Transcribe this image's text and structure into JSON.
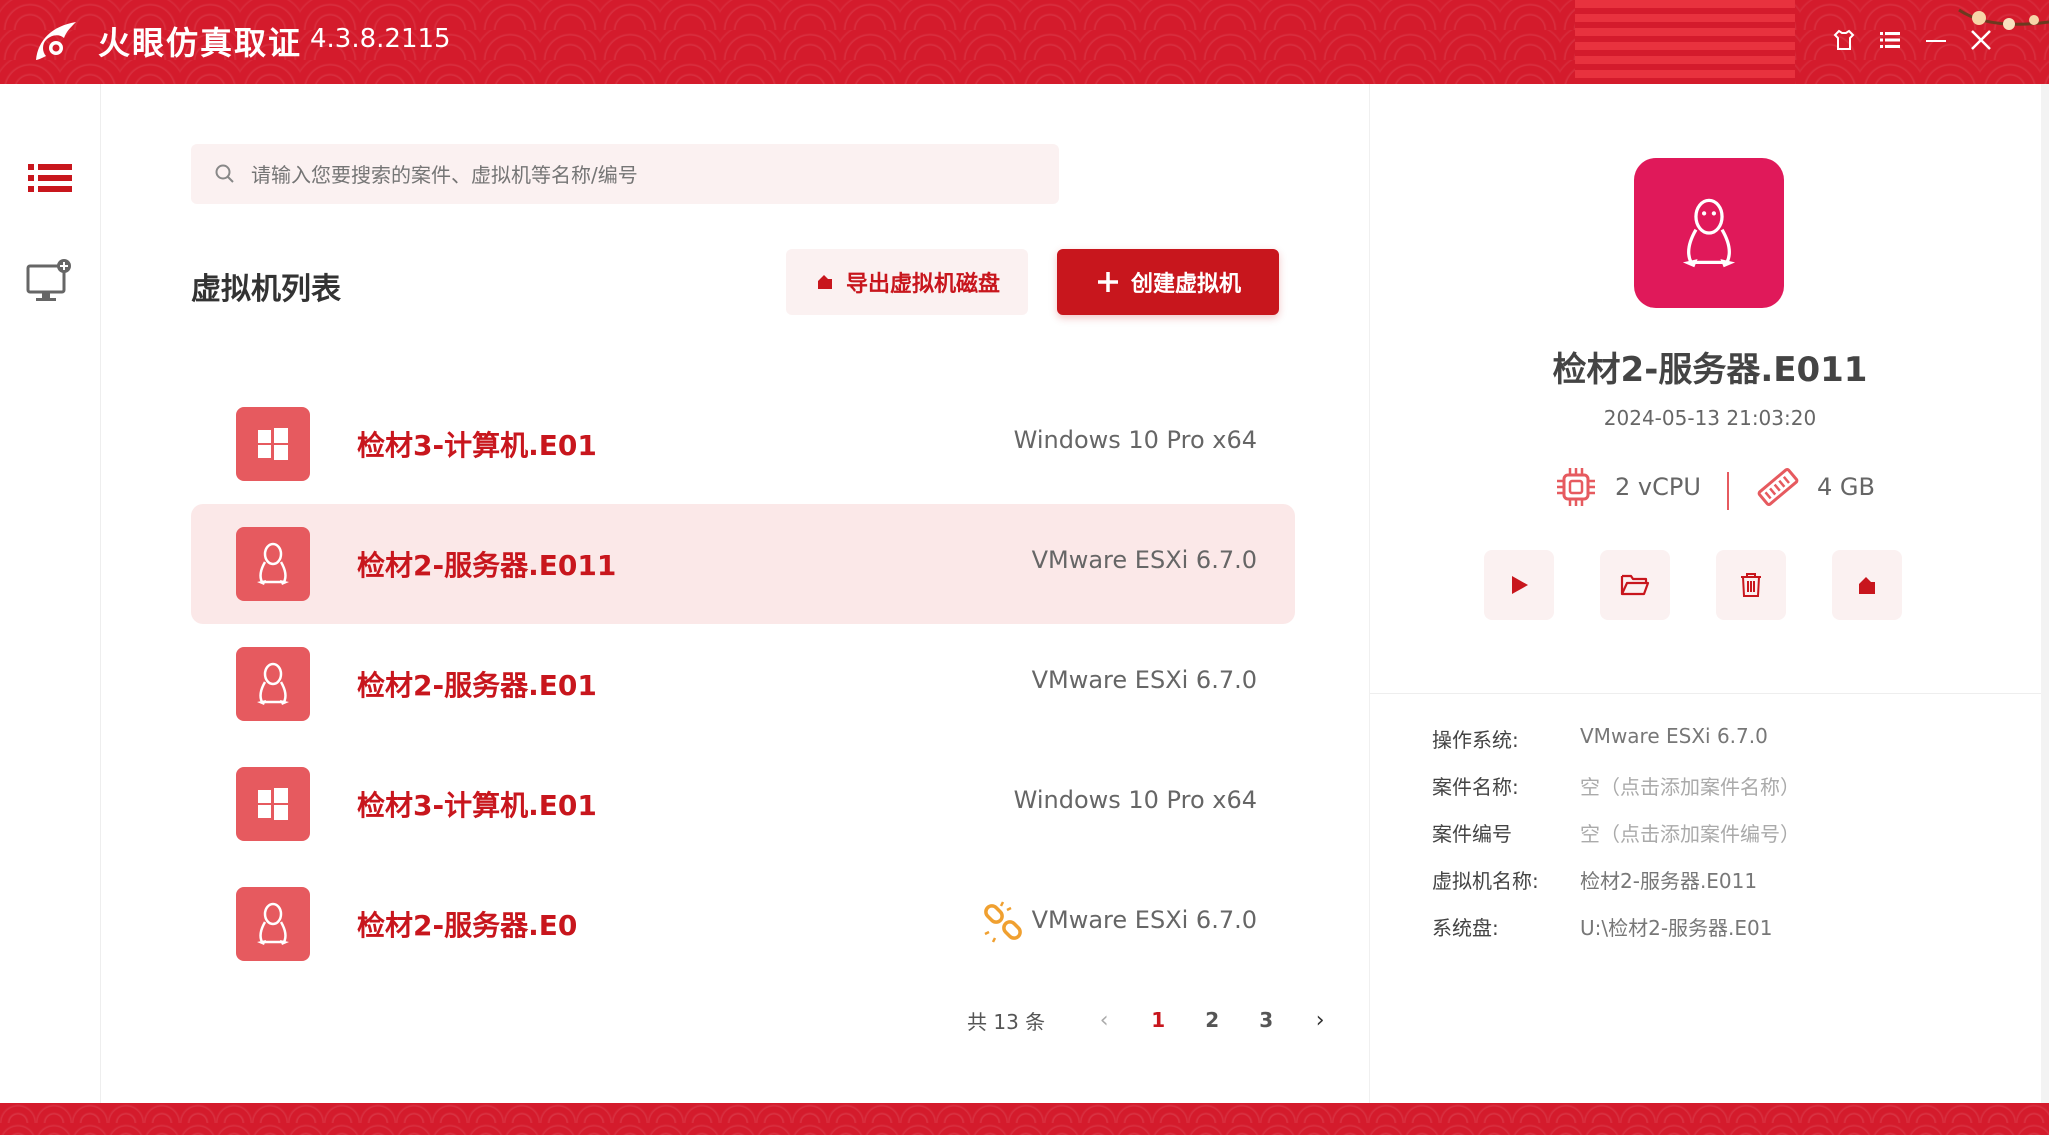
{
  "app": {
    "title": "火眼仿真取证",
    "version": "4.3.8.2115",
    "colors": {
      "brand": "#d41b2c",
      "accent": "#c8161d",
      "icon_bg": "#e65a5f",
      "linux_detail_bg": "#e0195a"
    }
  },
  "search": {
    "placeholder": "请输入您要搜索的案件、虚拟机等名称/编号"
  },
  "main": {
    "title": "虚拟机列表",
    "export_label": "导出虚拟机磁盘",
    "create_label": "创建虚拟机"
  },
  "vms": [
    {
      "name": "检材3-计算机.E01",
      "os": "Windows 10 Pro x64",
      "icon": "windows-icon",
      "selected": false
    },
    {
      "name": "检材2-服务器.E011",
      "os": "VMware ESXi 6.7.0",
      "icon": "linux-icon",
      "selected": true
    },
    {
      "name": "检材2-服务器.E01",
      "os": "VMware ESXi 6.7.0",
      "icon": "linux-icon",
      "selected": false
    },
    {
      "name": "检材3-计算机.E01",
      "os": "Windows 10 Pro x64",
      "icon": "windows-icon",
      "selected": false
    },
    {
      "name": "检材2-服务器.E0",
      "os": "VMware ESXi 6.7.0",
      "icon": "linux-icon",
      "selected": false,
      "link_broken": true
    }
  ],
  "pager": {
    "total": "共 13 条",
    "pages": [
      "1",
      "2",
      "3"
    ],
    "current": "1"
  },
  "detail": {
    "name": "检材2-服务器.E011",
    "time": "2024-05-13 21:03:20",
    "cpu": "2 vCPU",
    "memory": "4 GB",
    "info": [
      {
        "label": "操作系统:",
        "value": "VMware ESXi 6.7.0"
      },
      {
        "label": "案件名称:",
        "value": "空（点击添加案件名称）"
      },
      {
        "label": "案件编号",
        "value": "空（点击添加案件编号）"
      },
      {
        "label": "虚拟机名称:",
        "value": "检材2-服务器.E011"
      },
      {
        "label": "系统盘:",
        "value": "U:\\检材2-服务器.E01"
      }
    ]
  }
}
